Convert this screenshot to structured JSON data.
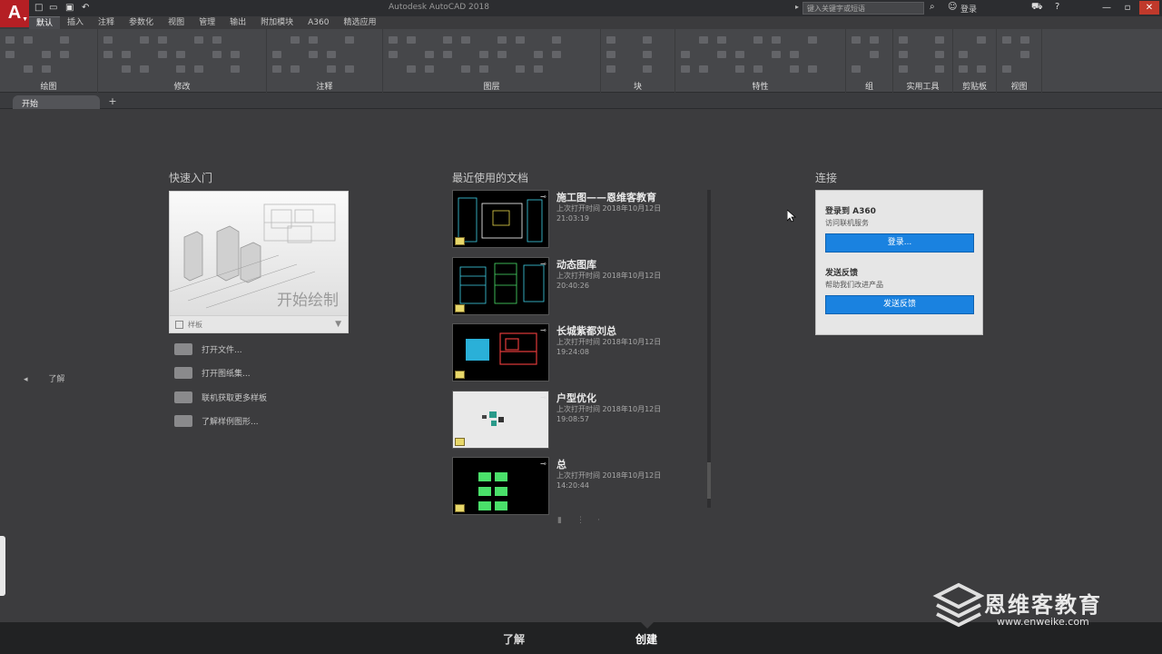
{
  "app": {
    "logo": "A",
    "window_title": "Autodesk AutoCAD 2018",
    "search_placeholder": "键入关键字或短语",
    "login_label": "登录"
  },
  "ribbon": {
    "tabs": [
      "默认",
      "插入",
      "注释",
      "参数化",
      "视图",
      "管理",
      "输出",
      "附加模块",
      "A360",
      "精选应用"
    ],
    "active_tab": "默认",
    "groups": [
      "绘图",
      "修改",
      "注释",
      "图层",
      "块",
      "特性",
      "组",
      "实用工具",
      "剪贴板",
      "视图"
    ]
  },
  "doctabs": {
    "start_tab": "开始",
    "add": "+"
  },
  "left_nav": {
    "arrow": "◂",
    "label": "了解"
  },
  "quick_start": {
    "title": "快速入门",
    "card_caption": "开始绘制",
    "template_label": "样板",
    "links": [
      "打开文件...",
      "打开图纸集...",
      "联机获取更多样板",
      "了解样例图形..."
    ]
  },
  "recent": {
    "title": "最近使用的文档",
    "documents": [
      {
        "name": "施工图——恩维客教育",
        "time_label": "上次打开时间 2018年10月12日",
        "time": "21:03:19"
      },
      {
        "name": "动态图库",
        "time_label": "上次打开时间 2018年10月12日",
        "time": "20:40:26"
      },
      {
        "name": "长城紫都刘总",
        "time_label": "上次打开时间 2018年10月12日",
        "time": "19:24:08"
      },
      {
        "name": "户型优化",
        "time_label": "上次打开时间 2018年10月12日",
        "time": "19:08:57"
      },
      {
        "name": "总",
        "time_label": "上次打开时间 2018年10月12日",
        "time": "14:20:44"
      }
    ]
  },
  "connect": {
    "title": "连接",
    "a360_heading": "登录到 A360",
    "a360_sub": "访问联机服务",
    "login_button": "登录...",
    "feedback_heading": "发送反馈",
    "feedback_sub": "帮助我们改进产品",
    "feedback_button": "发送反馈"
  },
  "bottom_tabs": {
    "learn": "了解",
    "create": "创建"
  },
  "watermark": {
    "text": "恩维客教育",
    "url": "www.enweike.com"
  }
}
